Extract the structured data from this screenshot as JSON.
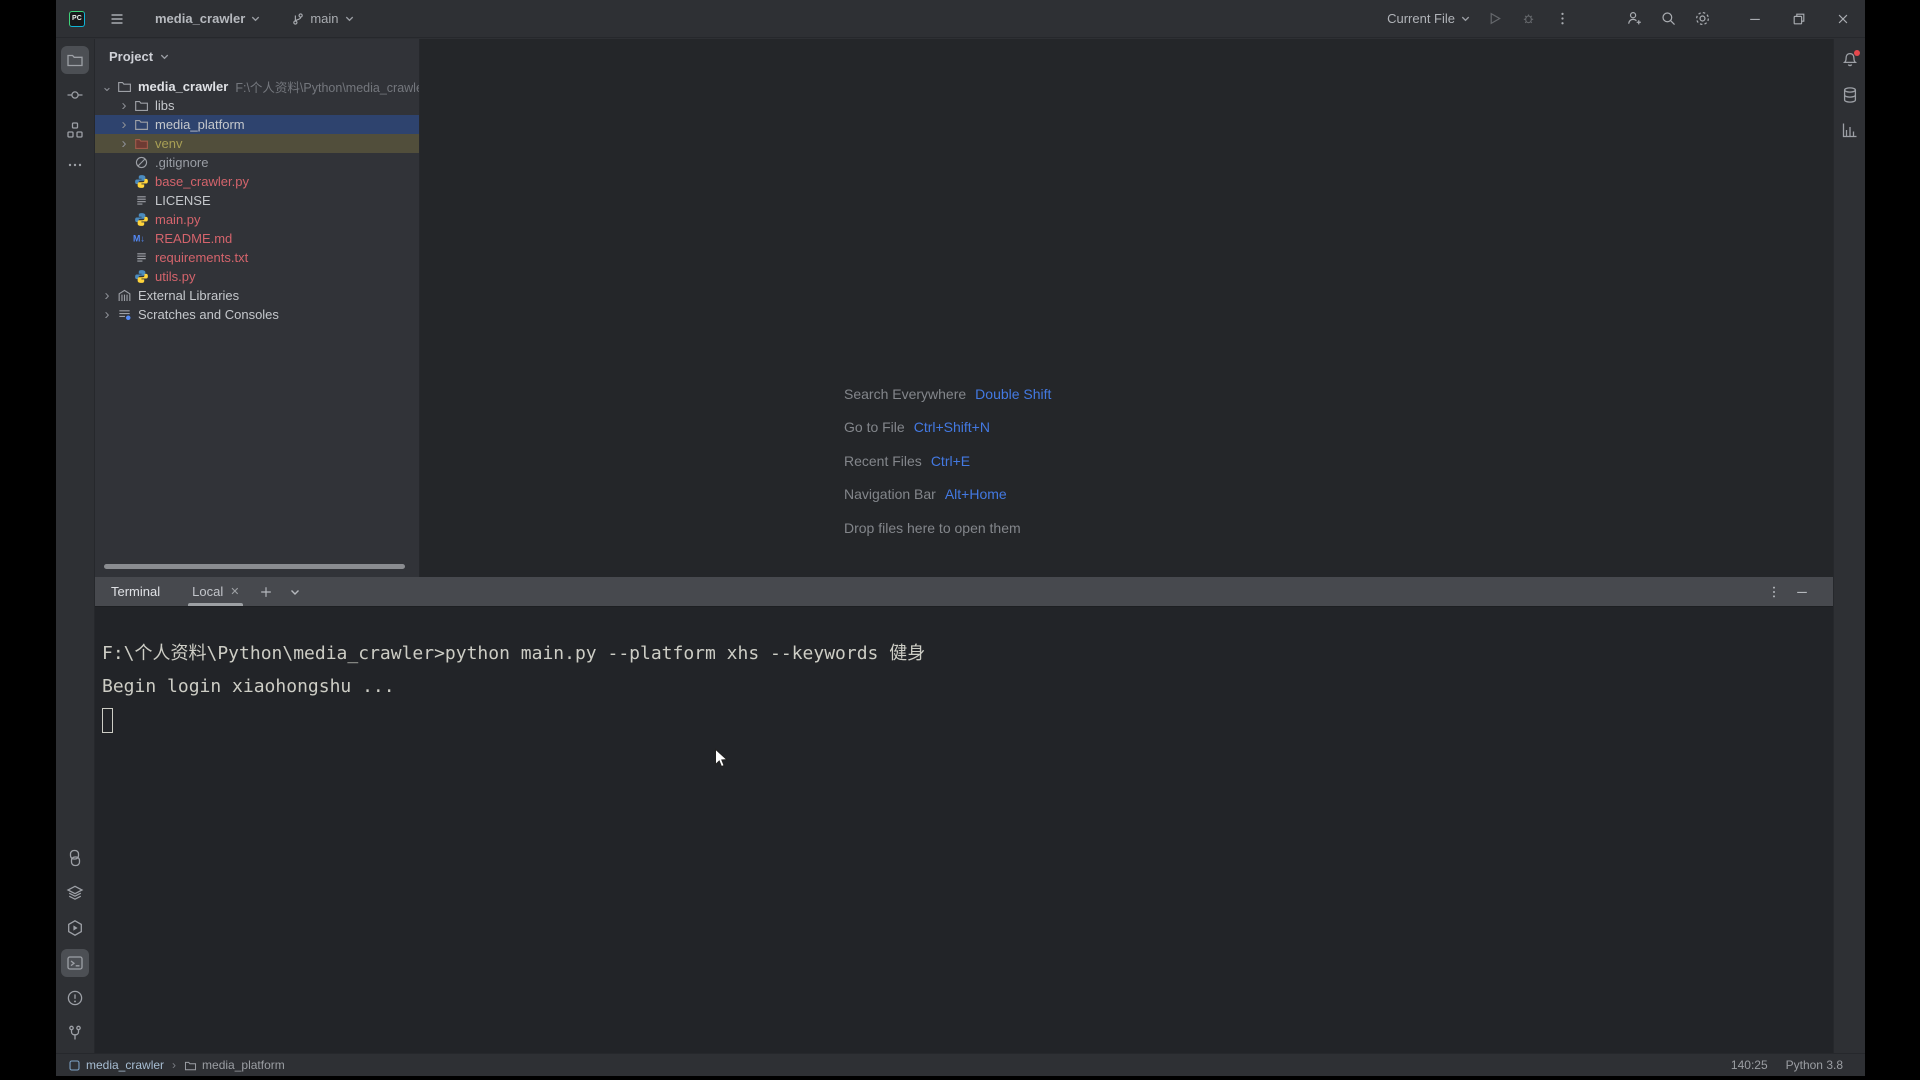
{
  "colors": {
    "accent": "#4379e2",
    "selection": "#2e436e",
    "excluded_row": "#514e3b",
    "excluded_text": "#a89f55",
    "vcs_red": "#d4646c",
    "notification_dot": "#e5484d"
  },
  "titlebar": {
    "logo": "PC",
    "project_selector": "media_crawler",
    "branch": "main",
    "run_config": "Current File",
    "left_icons": [
      "hamburger-menu-icon",
      "chevron-down-icon",
      "git-branch-icon"
    ],
    "right_icons": [
      "run-icon",
      "debug-icon",
      "more-vertical-icon",
      "add-user-icon",
      "search-icon",
      "gear-icon",
      "minimize-icon",
      "maximize-icon",
      "close-icon"
    ]
  },
  "left_stripe": {
    "top": [
      {
        "icon": "project-folder",
        "name": "project-tool-button",
        "selected": true
      },
      {
        "icon": "commit",
        "name": "commit-tool-button",
        "selected": false
      },
      {
        "icon": "structure",
        "name": "structure-tool-button",
        "selected": false
      },
      {
        "icon": "more-horizontal",
        "name": "more-tools-button",
        "selected": false
      }
    ],
    "bottom": [
      {
        "icon": "python",
        "name": "python-console-tool-button",
        "selected": false
      },
      {
        "icon": "layers",
        "name": "python-packages-tool-button",
        "selected": false
      },
      {
        "icon": "services",
        "name": "services-tool-button",
        "selected": false
      },
      {
        "icon": "terminal",
        "name": "terminal-tool-button",
        "selected": true
      },
      {
        "icon": "problems",
        "name": "problems-tool-button",
        "selected": false
      },
      {
        "icon": "vcs",
        "name": "version-control-tool-button",
        "selected": false
      }
    ]
  },
  "right_stripe": [
    {
      "icon": "bell",
      "name": "notifications-tool-button",
      "dot": true
    },
    {
      "icon": "database",
      "name": "database-tool-button",
      "dot": false
    },
    {
      "icon": "chart",
      "name": "plots-tool-button",
      "dot": false
    }
  ],
  "project_panel": {
    "header": "Project",
    "tree": [
      {
        "label": "media_crawler",
        "path": "F:\\个人资料\\Python\\media_crawle",
        "level": 0,
        "icon": "folder",
        "chevron": "expanded",
        "style": "root"
      },
      {
        "label": "libs",
        "level": 1,
        "icon": "folder",
        "chevron": "collapsed",
        "style": "normal"
      },
      {
        "label": "media_platform",
        "level": 1,
        "icon": "folder",
        "chevron": "collapsed",
        "style": "selected"
      },
      {
        "label": "venv",
        "level": 1,
        "icon": "folder-excluded",
        "chevron": "collapsed",
        "style": "excluded"
      },
      {
        "label": ".gitignore",
        "level": 1,
        "icon": "ignored",
        "chevron": "none",
        "style": "dim"
      },
      {
        "label": "base_crawler.py",
        "level": 1,
        "icon": "python-file",
        "chevron": "none",
        "style": "red"
      },
      {
        "label": "LICENSE",
        "level": 1,
        "icon": "text-file",
        "chevron": "none",
        "style": "normal"
      },
      {
        "label": "main.py",
        "level": 1,
        "icon": "python-file",
        "chevron": "none",
        "style": "red"
      },
      {
        "label": "README.md",
        "level": 1,
        "icon": "markdown-file",
        "chevron": "none",
        "style": "red"
      },
      {
        "label": "requirements.txt",
        "level": 1,
        "icon": "text-file",
        "chevron": "none",
        "style": "red"
      },
      {
        "label": "utils.py",
        "level": 1,
        "icon": "python-file",
        "chevron": "none",
        "style": "red"
      },
      {
        "label": "External Libraries",
        "level": 0,
        "icon": "libraries",
        "chevron": "collapsed",
        "style": "normal"
      },
      {
        "label": "Scratches and Consoles",
        "level": 0,
        "icon": "scratches",
        "chevron": "collapsed",
        "style": "normal"
      }
    ]
  },
  "editor": {
    "shortcuts": [
      {
        "label": "Search Everywhere",
        "keys": "Double Shift"
      },
      {
        "label": "Go to File",
        "keys": "Ctrl+Shift+N"
      },
      {
        "label": "Recent Files",
        "keys": "Ctrl+E"
      },
      {
        "label": "Navigation Bar",
        "keys": "Alt+Home"
      }
    ],
    "drop_hint": "Drop files here to open them"
  },
  "terminal": {
    "title": "Terminal",
    "tab": "Local",
    "lines": [
      "F:\\个人资料\\Python\\media_crawler>python main.py --platform xhs --keywords 健身",
      "Begin login xiaohongshu ..."
    ],
    "cursor_visible": true
  },
  "statusbar": {
    "breadcrumbs": [
      "media_crawler",
      "media_platform"
    ],
    "cursor_position": "140:25",
    "interpreter": "Python 3.8"
  }
}
